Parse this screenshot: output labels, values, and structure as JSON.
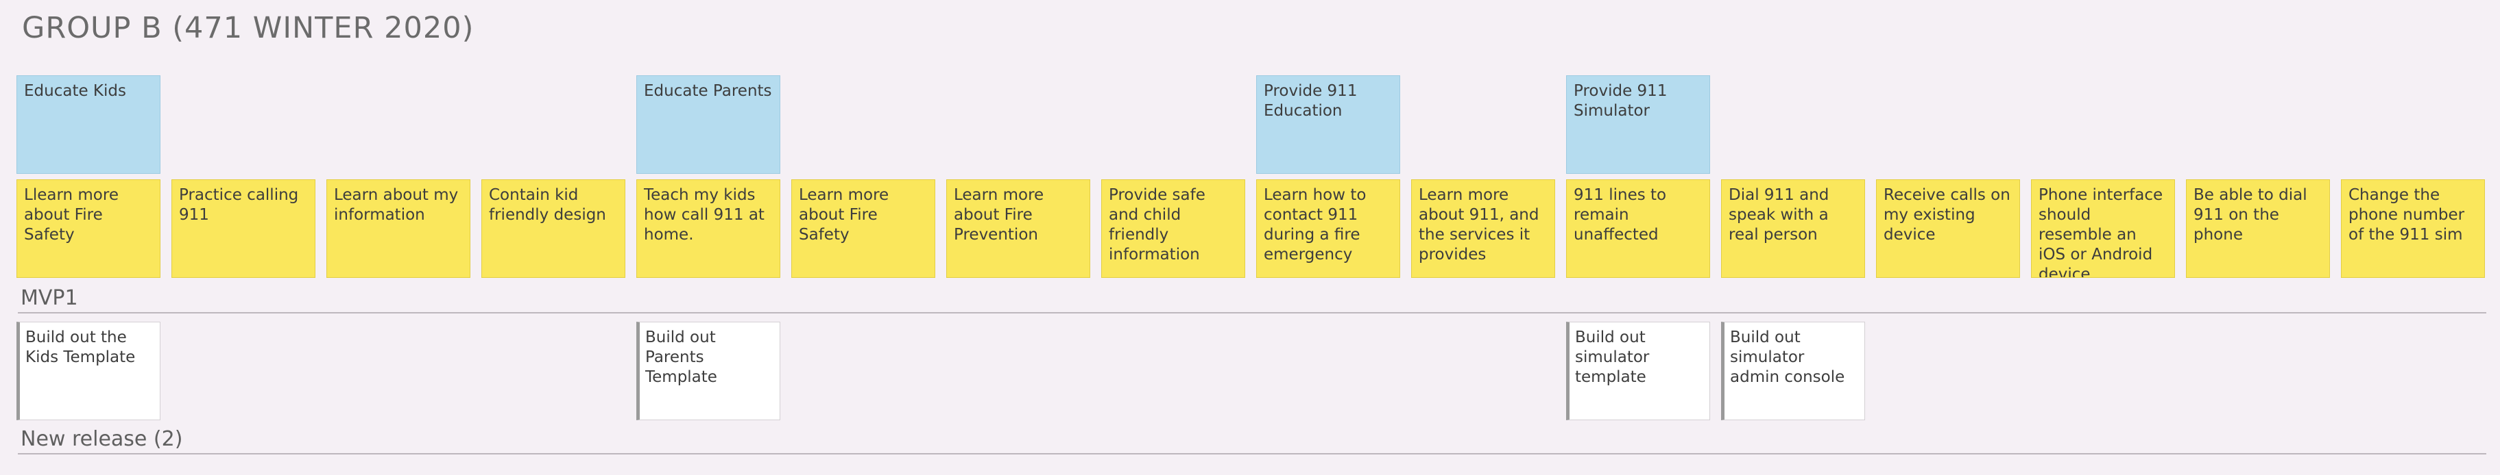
{
  "board": {
    "title": "GROUP B (471 WINTER 2020)"
  },
  "activities": [
    {
      "label": "Educate Kids",
      "col": 0
    },
    {
      "label": "Educate Parents",
      "col": 4
    },
    {
      "label": "Provide 911 Education",
      "col": 8
    },
    {
      "label": "Provide 911 Simulator",
      "col": 10
    }
  ],
  "tasks": [
    "Llearn more about Fire Safety",
    "Practice calling 911",
    "Learn about my information",
    "Contain kid friendly design",
    "Teach my kids how call 911 at home.",
    "Learn more about Fire Safety",
    "Learn more about Fire Prevention",
    "Provide safe and child friendly information",
    "Learn how to contact 911 during a fire emergency",
    "Learn more about 911, and the services it provides",
    "911 lines to remain unaffected",
    "Dial 911 and speak with a real person",
    "Receive calls on my existing device",
    "Phone interface should resemble an iOS or Android device",
    "Be able to dial 911 on the phone",
    "Change the phone number of the 911 sim"
  ],
  "releases": [
    {
      "label": "MVP1",
      "stories": [
        {
          "label": "Build out the Kids Template",
          "col": 0
        },
        {
          "label": "Build out Parents Template",
          "col": 4
        },
        {
          "label": "Build out simulator template",
          "col": 10
        },
        {
          "label": "Build out simulator admin console",
          "col": 11
        }
      ]
    },
    {
      "label": "New release (2)",
      "stories": []
    }
  ]
}
